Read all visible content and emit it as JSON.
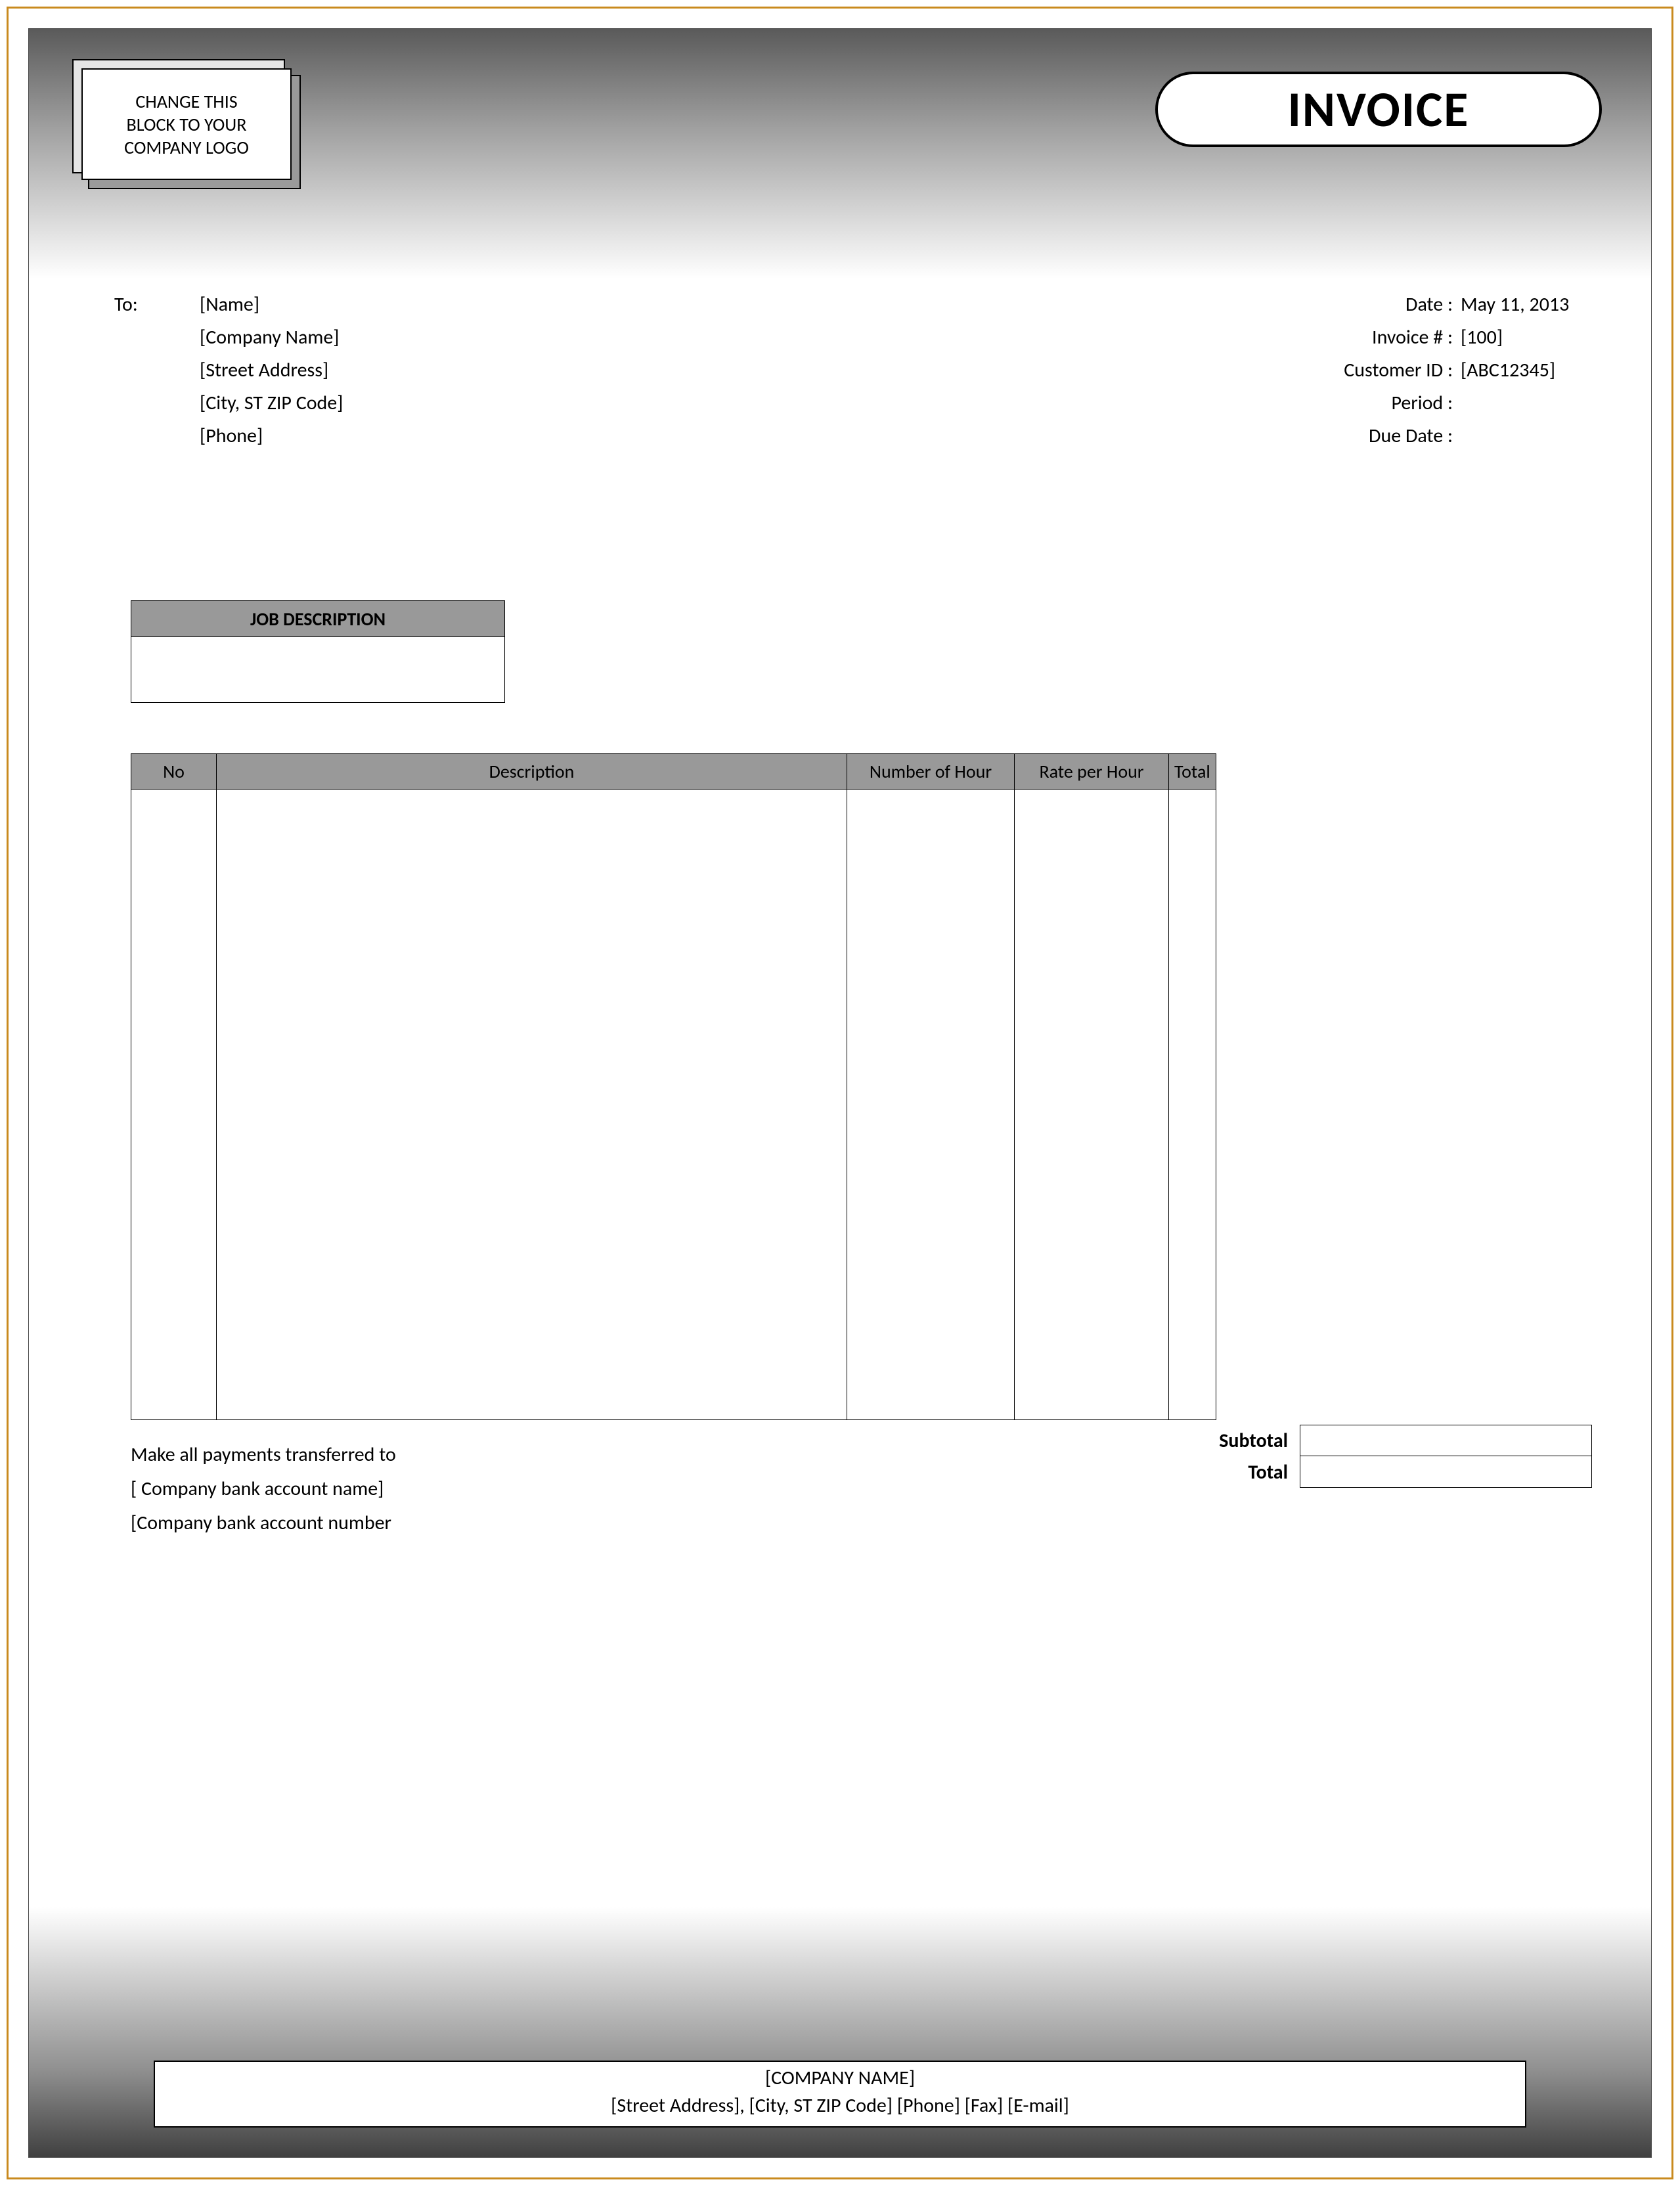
{
  "header": {
    "logo_placeholder_l1": "CHANGE THIS",
    "logo_placeholder_l2": "BLOCK TO YOUR",
    "logo_placeholder_l3": "COMPANY LOGO",
    "title": "INVOICE"
  },
  "to": {
    "label": "To:",
    "name": "[Name]",
    "company": "[Company Name]",
    "street": "[Street Address]",
    "city_st_zip": "[City, ST  ZIP Code]",
    "phone": "[Phone]"
  },
  "meta": {
    "date_label": "Date :",
    "date_value": "May 11, 2013",
    "invoice_no_label": "Invoice # :",
    "invoice_no_value": "[100]",
    "customer_id_label": "Customer ID :",
    "customer_id_value": "[ABC12345]",
    "period_label": "Period :",
    "period_value": "",
    "due_date_label": "Due Date :",
    "due_date_value": ""
  },
  "job_description": {
    "header": "JOB DESCRIPTION",
    "body": ""
  },
  "columns": {
    "no": "No",
    "description": "Description",
    "hours": "Number of Hour",
    "rate": "Rate per Hour",
    "total": "Total"
  },
  "summary": {
    "subtotal_label": "Subtotal",
    "subtotal_value": "",
    "total_label": "Total",
    "total_value": ""
  },
  "payment": {
    "line1": "Make all payments transferred to",
    "line2": "[ Company bank account name]",
    "line3": "[Company bank account number"
  },
  "footer": {
    "company": "[COMPANY NAME]",
    "contact": "[Street Address], [City, ST  ZIP Code]  [Phone]  [Fax]  [E-mail]"
  }
}
